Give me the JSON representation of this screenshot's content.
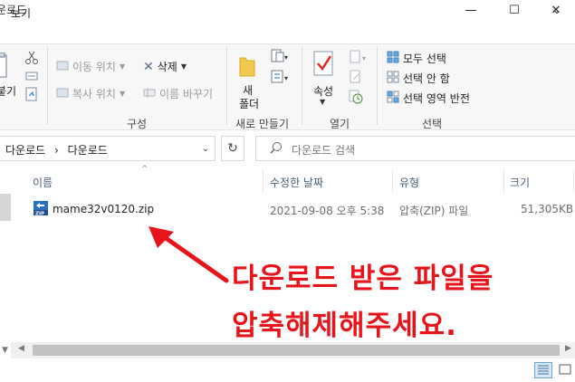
{
  "window": {
    "title": "운로드",
    "minimize_glyph": "—",
    "maximize_glyph": "☐",
    "close_glyph": "✕"
  },
  "ribbon_tabs": {
    "view": "보기",
    "expand_glyph": "⌄"
  },
  "ribbon": {
    "clipboard": {
      "paste_partial": "붙기"
    },
    "organize": {
      "move_to": "이동 위치",
      "copy_to": "복사 위치",
      "delete": "삭제",
      "rename": "이름 바꾸기",
      "group_label": "구성"
    },
    "new": {
      "new_folder_line1": "새",
      "new_folder_line2": "폴더",
      "group_label": "새로 만들기"
    },
    "open": {
      "properties": "속성",
      "group_label": "열기"
    },
    "select": {
      "select_all": "모두 선택",
      "select_none": "선택 안 함",
      "invert_selection": "선택 영역 반전",
      "group_label": "선택"
    }
  },
  "address": {
    "crumbs": [
      "다운로드",
      "다운로드"
    ],
    "separator": "›",
    "search_placeholder": "다운로드 검색"
  },
  "columns": {
    "name": "이름",
    "modified": "수정한 날짜",
    "type": "유형",
    "size": "크기"
  },
  "files": [
    {
      "name": "mame32v0120.zip",
      "modified": "2021-09-08 오후 5:38",
      "type": "압축(ZIP) 파일",
      "size": "51,305KB",
      "icon": "zip-file-icon"
    }
  ],
  "annotation": {
    "line1": "다운로드 받은 파일을",
    "line2": "압축해제해주세요.",
    "color": "#e8141c"
  },
  "colors": {
    "accent": "#1e6fd0",
    "header_text": "#4c607a",
    "annotation": "#e8141c"
  }
}
